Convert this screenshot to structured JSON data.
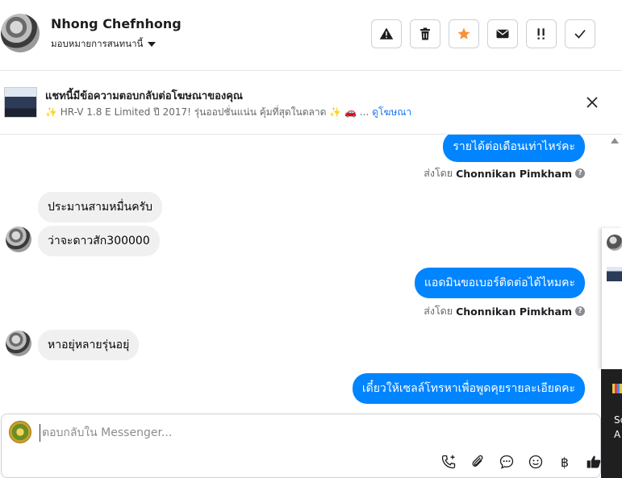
{
  "header": {
    "contact_name": "Nhong Chefnhong",
    "assign_label": "มอบหมายการสนทนานี้",
    "actions": [
      {
        "name": "spam-button",
        "icon": "warning-icon"
      },
      {
        "name": "delete-button",
        "icon": "trash-icon"
      },
      {
        "name": "star-button",
        "icon": "star-icon",
        "color": "#f7923a"
      },
      {
        "name": "mark-unread-button",
        "icon": "envelope-icon"
      },
      {
        "name": "follow-up-button",
        "icon": "exclamation-icon"
      },
      {
        "name": "done-button",
        "icon": "check-icon"
      }
    ]
  },
  "ad": {
    "title": "แชทนี้มีข้อความตอบกลับต่อโฆษณาของคุณ",
    "description": "✨ HR-V 1.8 E Limited ปี 2017! รุ่นออปชั่นแน่น คุ้มที่สุดในตลาด ✨ 🚗 ...",
    "link": "ดูโฆษณา"
  },
  "messages": {
    "m1": "รายได้ต่อเดือนเท่าไหร่คะ",
    "m2": "ประมานสามหมื่นครับ",
    "m3": "ว่าจะดาวสัก300000",
    "m4": "แอดมินขอเบอร์ติดต่อได้ไหมคะ",
    "m5": "หาอยุ่หลายรุ่นอยุ่",
    "m6": "เดี๋ยวให้เซลล์โทรหาเพื่อพูดคุยรายละเอียดคะ"
  },
  "sent_by": {
    "prefix": "ส่งโดย",
    "name": "Chonnikan Pimkham"
  },
  "side_panel": {
    "line1": "Sc",
    "line2": "A"
  },
  "composer": {
    "placeholder": "ตอบกลับใน Messenger...",
    "baht_symbol": "฿"
  },
  "colors": {
    "outgoing_bubble": "#0084ff",
    "incoming_bubble": "#f0f0f0",
    "link": "#1877f2"
  }
}
